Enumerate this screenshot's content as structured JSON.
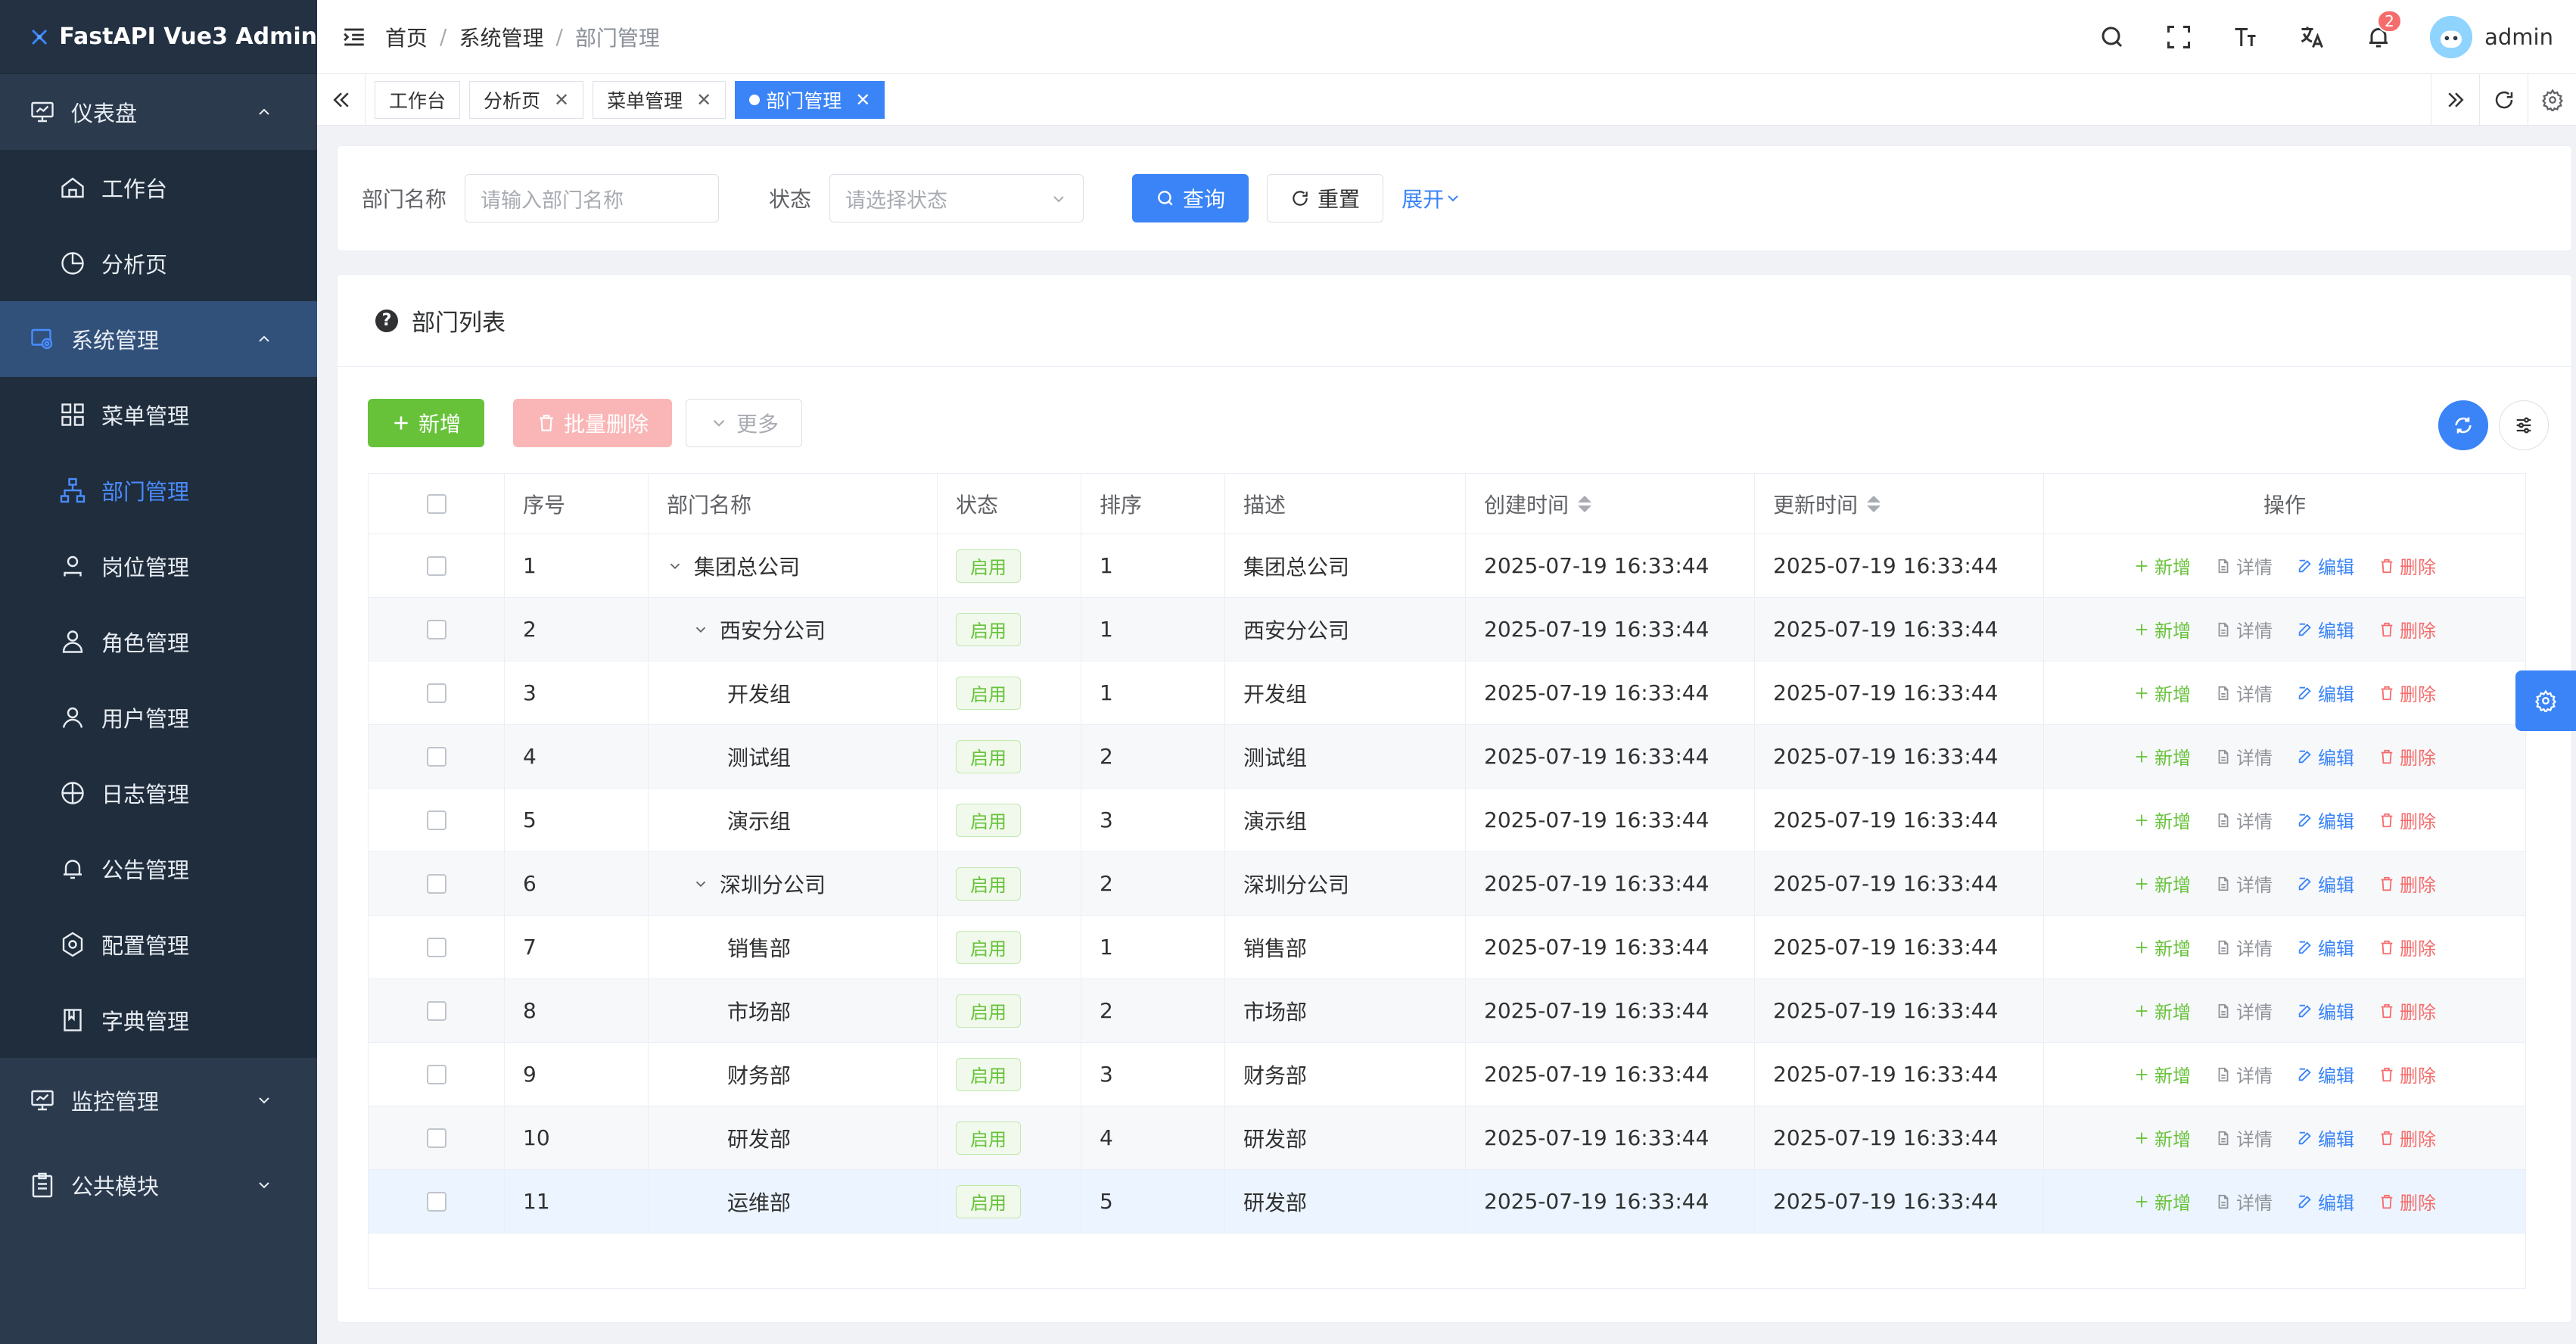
{
  "app": {
    "title": "FastAPI Vue3 Admin"
  },
  "sidebar": {
    "groups": [
      {
        "label": "仪表盘",
        "items": [
          {
            "label": "工作台"
          },
          {
            "label": "分析页"
          }
        ]
      },
      {
        "label": "系统管理",
        "items": [
          {
            "label": "菜单管理"
          },
          {
            "label": "部门管理"
          },
          {
            "label": "岗位管理"
          },
          {
            "label": "角色管理"
          },
          {
            "label": "用户管理"
          },
          {
            "label": "日志管理"
          },
          {
            "label": "公告管理"
          },
          {
            "label": "配置管理"
          },
          {
            "label": "字典管理"
          }
        ]
      },
      {
        "label": "监控管理"
      },
      {
        "label": "公共模块"
      }
    ]
  },
  "header": {
    "breadcrumb": [
      "首页",
      "系统管理",
      "部门管理"
    ],
    "separator": "/",
    "notification_count": "2",
    "username": "admin"
  },
  "tags": [
    {
      "label": "工作台",
      "closable": false
    },
    {
      "label": "分析页",
      "closable": true
    },
    {
      "label": "菜单管理",
      "closable": true
    },
    {
      "label": "部门管理",
      "closable": true,
      "active": true
    }
  ],
  "tag_close": "✕",
  "search": {
    "name_label": "部门名称",
    "name_placeholder": "请输入部门名称",
    "status_label": "状态",
    "status_placeholder": "请选择状态",
    "query_btn": "查询",
    "reset_btn": "重置",
    "expand_btn": "展开"
  },
  "list": {
    "title": "部门列表",
    "help": "?",
    "add_btn": "新增",
    "batch_delete_btn": "批量删除",
    "more_btn": "更多"
  },
  "table": {
    "headers": [
      "序号",
      "部门名称",
      "状态",
      "排序",
      "描述",
      "创建时间",
      "更新时间",
      "操作"
    ],
    "ops": {
      "add": "新增",
      "detail": "详情",
      "edit": "编辑",
      "delete": "删除"
    },
    "rows": [
      {
        "no": "1",
        "name": "集团总公司",
        "status": "启用",
        "sort": "1",
        "desc": "集团总公司",
        "created": "2025-07-19 16:33:44",
        "updated": "2025-07-19 16:33:44"
      },
      {
        "no": "2",
        "name": "西安分公司",
        "status": "启用",
        "sort": "1",
        "desc": "西安分公司",
        "created": "2025-07-19 16:33:44",
        "updated": "2025-07-19 16:33:44"
      },
      {
        "no": "3",
        "name": "开发组",
        "status": "启用",
        "sort": "1",
        "desc": "开发组",
        "created": "2025-07-19 16:33:44",
        "updated": "2025-07-19 16:33:44"
      },
      {
        "no": "4",
        "name": "测试组",
        "status": "启用",
        "sort": "2",
        "desc": "测试组",
        "created": "2025-07-19 16:33:44",
        "updated": "2025-07-19 16:33:44"
      },
      {
        "no": "5",
        "name": "演示组",
        "status": "启用",
        "sort": "3",
        "desc": "演示组",
        "created": "2025-07-19 16:33:44",
        "updated": "2025-07-19 16:33:44"
      },
      {
        "no": "6",
        "name": "深圳分公司",
        "status": "启用",
        "sort": "2",
        "desc": "深圳分公司",
        "created": "2025-07-19 16:33:44",
        "updated": "2025-07-19 16:33:44"
      },
      {
        "no": "7",
        "name": "销售部",
        "status": "启用",
        "sort": "1",
        "desc": "销售部",
        "created": "2025-07-19 16:33:44",
        "updated": "2025-07-19 16:33:44"
      },
      {
        "no": "8",
        "name": "市场部",
        "status": "启用",
        "sort": "2",
        "desc": "市场部",
        "created": "2025-07-19 16:33:44",
        "updated": "2025-07-19 16:33:44"
      },
      {
        "no": "9",
        "name": "财务部",
        "status": "启用",
        "sort": "3",
        "desc": "财务部",
        "created": "2025-07-19 16:33:44",
        "updated": "2025-07-19 16:33:44"
      },
      {
        "no": "10",
        "name": "研发部",
        "status": "启用",
        "sort": "4",
        "desc": "研发部",
        "created": "2025-07-19 16:33:44",
        "updated": "2025-07-19 16:33:44"
      },
      {
        "no": "11",
        "name": "运维部",
        "status": "启用",
        "sort": "5",
        "desc": "研发部",
        "created": "2025-07-19 16:33:44",
        "updated": "2025-07-19 16:33:44"
      }
    ]
  },
  "colors": {
    "primary": "#3a84f7",
    "success": "#67c23a",
    "danger": "#f56c6c",
    "sidebar": "#2b3a4d"
  }
}
